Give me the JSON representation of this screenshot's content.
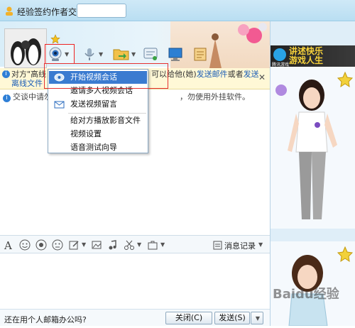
{
  "window": {
    "title": "经验签约作者交",
    "title_input_value": ""
  },
  "infobar": {
    "text_prefix": "对方\"高线",
    "text_mid": "可以给他(她)",
    "link_email": "发送邮件",
    "text_or": "或者",
    "link_send": "发送",
    "link_offline": "离线文件"
  },
  "chat": {
    "warning_prefix": "交谈中请勿",
    "warning_suffix": "，勿使用外挂软件。"
  },
  "video_menu": {
    "items": [
      {
        "label": "开始视频会话",
        "highlighted": true,
        "icon": "video-chat-icon"
      },
      {
        "label": "邀请多人视频会话",
        "highlighted": false,
        "icon": ""
      },
      {
        "label": "发送视频留言",
        "highlighted": false,
        "icon": "mail-icon"
      },
      {
        "label": "给对方播放影音文件",
        "highlighted": false,
        "icon": ""
      },
      {
        "label": "视频设置",
        "highlighted": false,
        "icon": ""
      },
      {
        "label": "语音测试向导",
        "highlighted": false,
        "icon": ""
      }
    ]
  },
  "format_bar": {
    "history_label": "消息记录"
  },
  "bottom": {
    "question": "还在用个人邮箱办公吗?",
    "close_label": "关闭(C)",
    "send_label": "发送(S)"
  },
  "right_panel": {
    "ad_title_line1": "讲述快乐",
    "ad_title_line2": "游戏人生",
    "ad_brand": "腾讯游戏"
  },
  "watermark": "Baidu经验",
  "colors": {
    "menu_highlight": "#3b7bd0",
    "link": "#1b5db5",
    "red_box": "#e53030"
  }
}
